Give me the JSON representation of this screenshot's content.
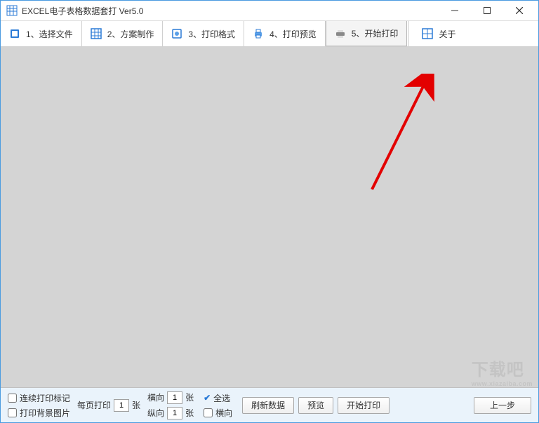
{
  "window": {
    "title": "EXCEL电子表格数据套打 Ver5.0"
  },
  "toolbar": {
    "items": [
      {
        "label": "1、选择文件"
      },
      {
        "label": "2、方案制作"
      },
      {
        "label": "3、打印格式"
      },
      {
        "label": "4、打印预览"
      },
      {
        "label": "5、开始打印"
      },
      {
        "label": "关于"
      }
    ]
  },
  "bottom": {
    "continuous_print_mark": "连续打印标记",
    "print_bg_image": "打印背景图片",
    "per_page_print": "每页打印",
    "sheets_suffix": "张",
    "horizontal": "横向",
    "vertical": "纵向",
    "page_h_value": "1",
    "page_v_value": "1",
    "per_page_value": "1",
    "select_all": "全选",
    "landscape": "横向",
    "refresh_data": "刷新数据",
    "preview": "预览",
    "start_print": "开始打印",
    "prev_step": "上一步"
  },
  "watermark": {
    "main": "下载吧",
    "sub": "www.xiazaiba.com"
  }
}
